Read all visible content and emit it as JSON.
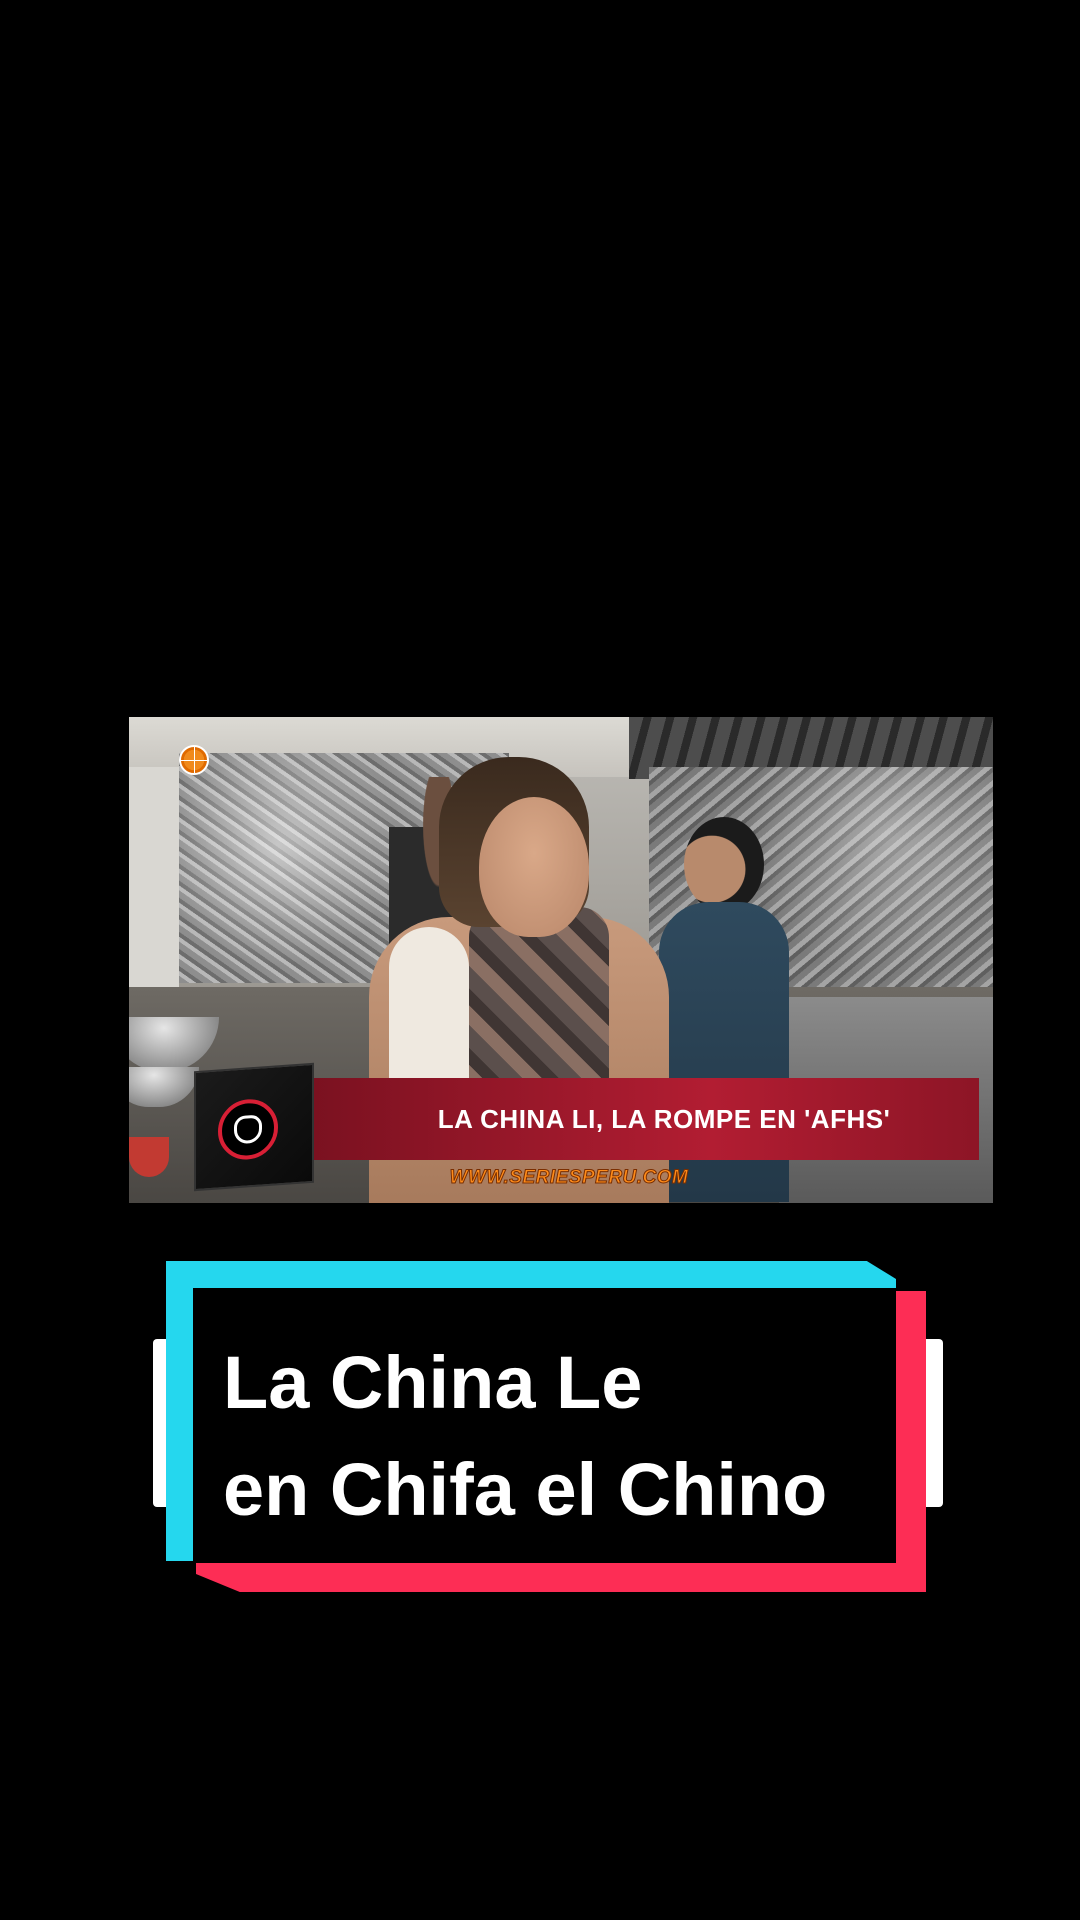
{
  "video": {
    "lower_third_text": "LA CHINA LI, LA ROMPE EN 'AFHS'",
    "watermark": "WWW.SERIESPERU.COM"
  },
  "caption": {
    "line1": "La China Le",
    "line2": "en Chifa el Chino"
  },
  "colors": {
    "background": "#000000",
    "caption_cyan": "#25d7ee",
    "caption_red": "#fd2d55",
    "lower_third_red": "#b21d32",
    "watermark_orange": "#ff8c1a"
  },
  "icons": [
    "america-tv-globe-icon",
    "show-logo-icon"
  ]
}
